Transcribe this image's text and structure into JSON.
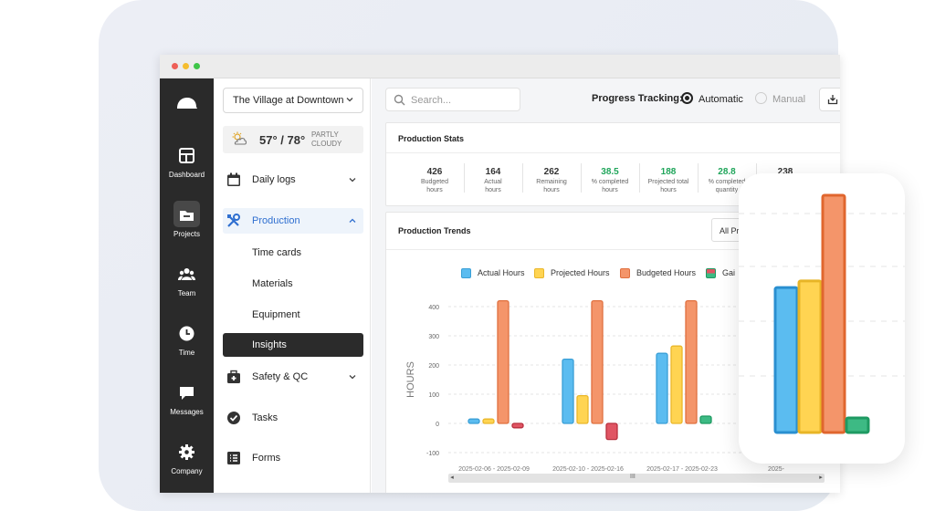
{
  "window_controls": {
    "close": "#ee5f57",
    "minimize": "#f5bd2e",
    "maximize": "#3ec548"
  },
  "rail": {
    "items": [
      {
        "label": "Dashboard",
        "icon": "dashboard-icon"
      },
      {
        "label": "Projects",
        "icon": "folder-icon",
        "active": true
      },
      {
        "label": "Team",
        "icon": "team-icon"
      },
      {
        "label": "Time",
        "icon": "clock-icon"
      },
      {
        "label": "Messages",
        "icon": "message-icon"
      },
      {
        "label": "Company",
        "icon": "gear-icon"
      }
    ]
  },
  "sidebar": {
    "project": "The Village at Downtown",
    "weather": {
      "temp": "57° / 78°",
      "condition_line1": "PARTLY",
      "condition_line2": "CLOUDY"
    },
    "nav": {
      "daily_logs": "Daily logs",
      "production": "Production",
      "time_cards": "Time cards",
      "materials": "Materials",
      "equipment": "Equipment",
      "insights": "Insights",
      "safety": "Safety & QC",
      "tasks": "Tasks",
      "forms": "Forms"
    }
  },
  "topbar": {
    "search_placeholder": "Search...",
    "progress_label": "Progress Tracking:",
    "automatic": "Automatic",
    "manual": "Manual",
    "selected_mode": "Automatic"
  },
  "stats": {
    "title": "Production Stats",
    "items": [
      {
        "value": "426",
        "label1": "Budgeted",
        "label2": "hours",
        "green": false
      },
      {
        "value": "164",
        "label1": "Actual",
        "label2": "hours",
        "green": false
      },
      {
        "value": "262",
        "label1": "Remaining",
        "label2": "hours",
        "green": false
      },
      {
        "value": "38.5",
        "label1": "% completed",
        "label2": "hours",
        "green": true
      },
      {
        "value": "188",
        "label1": "Projected total",
        "label2": "hours",
        "green": true
      },
      {
        "value": "28.8",
        "label1": "% completed",
        "label2": "quantity",
        "green": true
      },
      {
        "value": "238",
        "label1": "",
        "label2": "",
        "green": false
      }
    ]
  },
  "trends": {
    "title": "Production Trends",
    "filter_value": "All Pro",
    "scroll_grip": "III"
  },
  "colors": {
    "actual": "#5bbcf0",
    "projected": "#ffd452",
    "budgeted": "#f4956a",
    "gain_loss_red": "#e05563",
    "gain_loss_green": "#3dba84"
  },
  "chart_data": {
    "type": "bar",
    "ylabel": "HOURS",
    "ylim": [
      -100,
      400
    ],
    "yticks": [
      400,
      300,
      200,
      100,
      0,
      -100
    ],
    "legend": [
      {
        "name": "Actual Hours",
        "color": "#5bbcf0",
        "border": "#3a9fd6"
      },
      {
        "name": "Projected Hours",
        "color": "#ffd452",
        "border": "#eab72a"
      },
      {
        "name": "Budgeted Hours",
        "color": "#f4956a",
        "border": "#e0703f"
      },
      {
        "name": "Gai",
        "color": "#3dba84",
        "border": "#1e9a62"
      }
    ],
    "categories": [
      "2025-02-06 - 2025-02-09",
      "2025-02-10 - 2025-02-16",
      "2025-02-17 - 2025-02-23",
      "2025-"
    ],
    "series": [
      {
        "name": "Actual Hours",
        "values": [
          15,
          220,
          240,
          null
        ]
      },
      {
        "name": "Projected Hours",
        "values": [
          15,
          95,
          265,
          null
        ]
      },
      {
        "name": "Budgeted Hours",
        "values": [
          420,
          420,
          420,
          null
        ]
      },
      {
        "name": "Gai",
        "values": [
          -15,
          -55,
          25,
          null
        ]
      }
    ]
  },
  "zoom_chart": {
    "values": [
      440,
      460,
      720,
      30
    ]
  }
}
